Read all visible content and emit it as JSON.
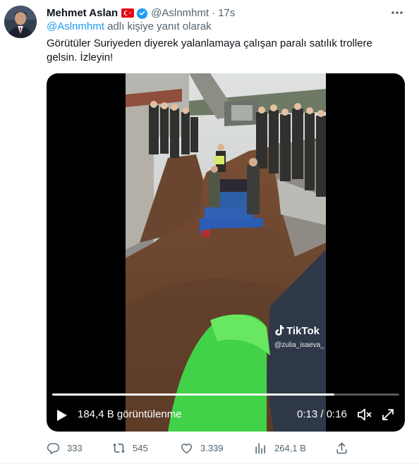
{
  "author": {
    "display_name": "Mehmet Aslan",
    "handle": "@Aslnmhmt",
    "separator": "·",
    "time": "17s",
    "flag_icon": "turkey-flag-icon",
    "verified_icon": "verified-badge-icon"
  },
  "reply": {
    "mention": "@Aslnmhmt",
    "suffix": "adlı kişiye yanıt olarak"
  },
  "tweet_text": "Görütüler Suriyeden diyerek yalanlamaya çalışan paralı satılık trollere gelsin. İzleyin!",
  "video": {
    "views_label": "184,4 B görüntülenme",
    "time_readout": "0:13 / 0:16",
    "progress": 0.8125,
    "watermark_brand": "TikTok",
    "watermark_user": "@zulia_isaeva_"
  },
  "actions": {
    "replies": "333",
    "retweets": "545",
    "likes": "3.339",
    "views": "264,1 B"
  },
  "colors": {
    "accent": "#1d9bf0",
    "secondary_text": "#536471",
    "primary_text": "#0f1419"
  }
}
